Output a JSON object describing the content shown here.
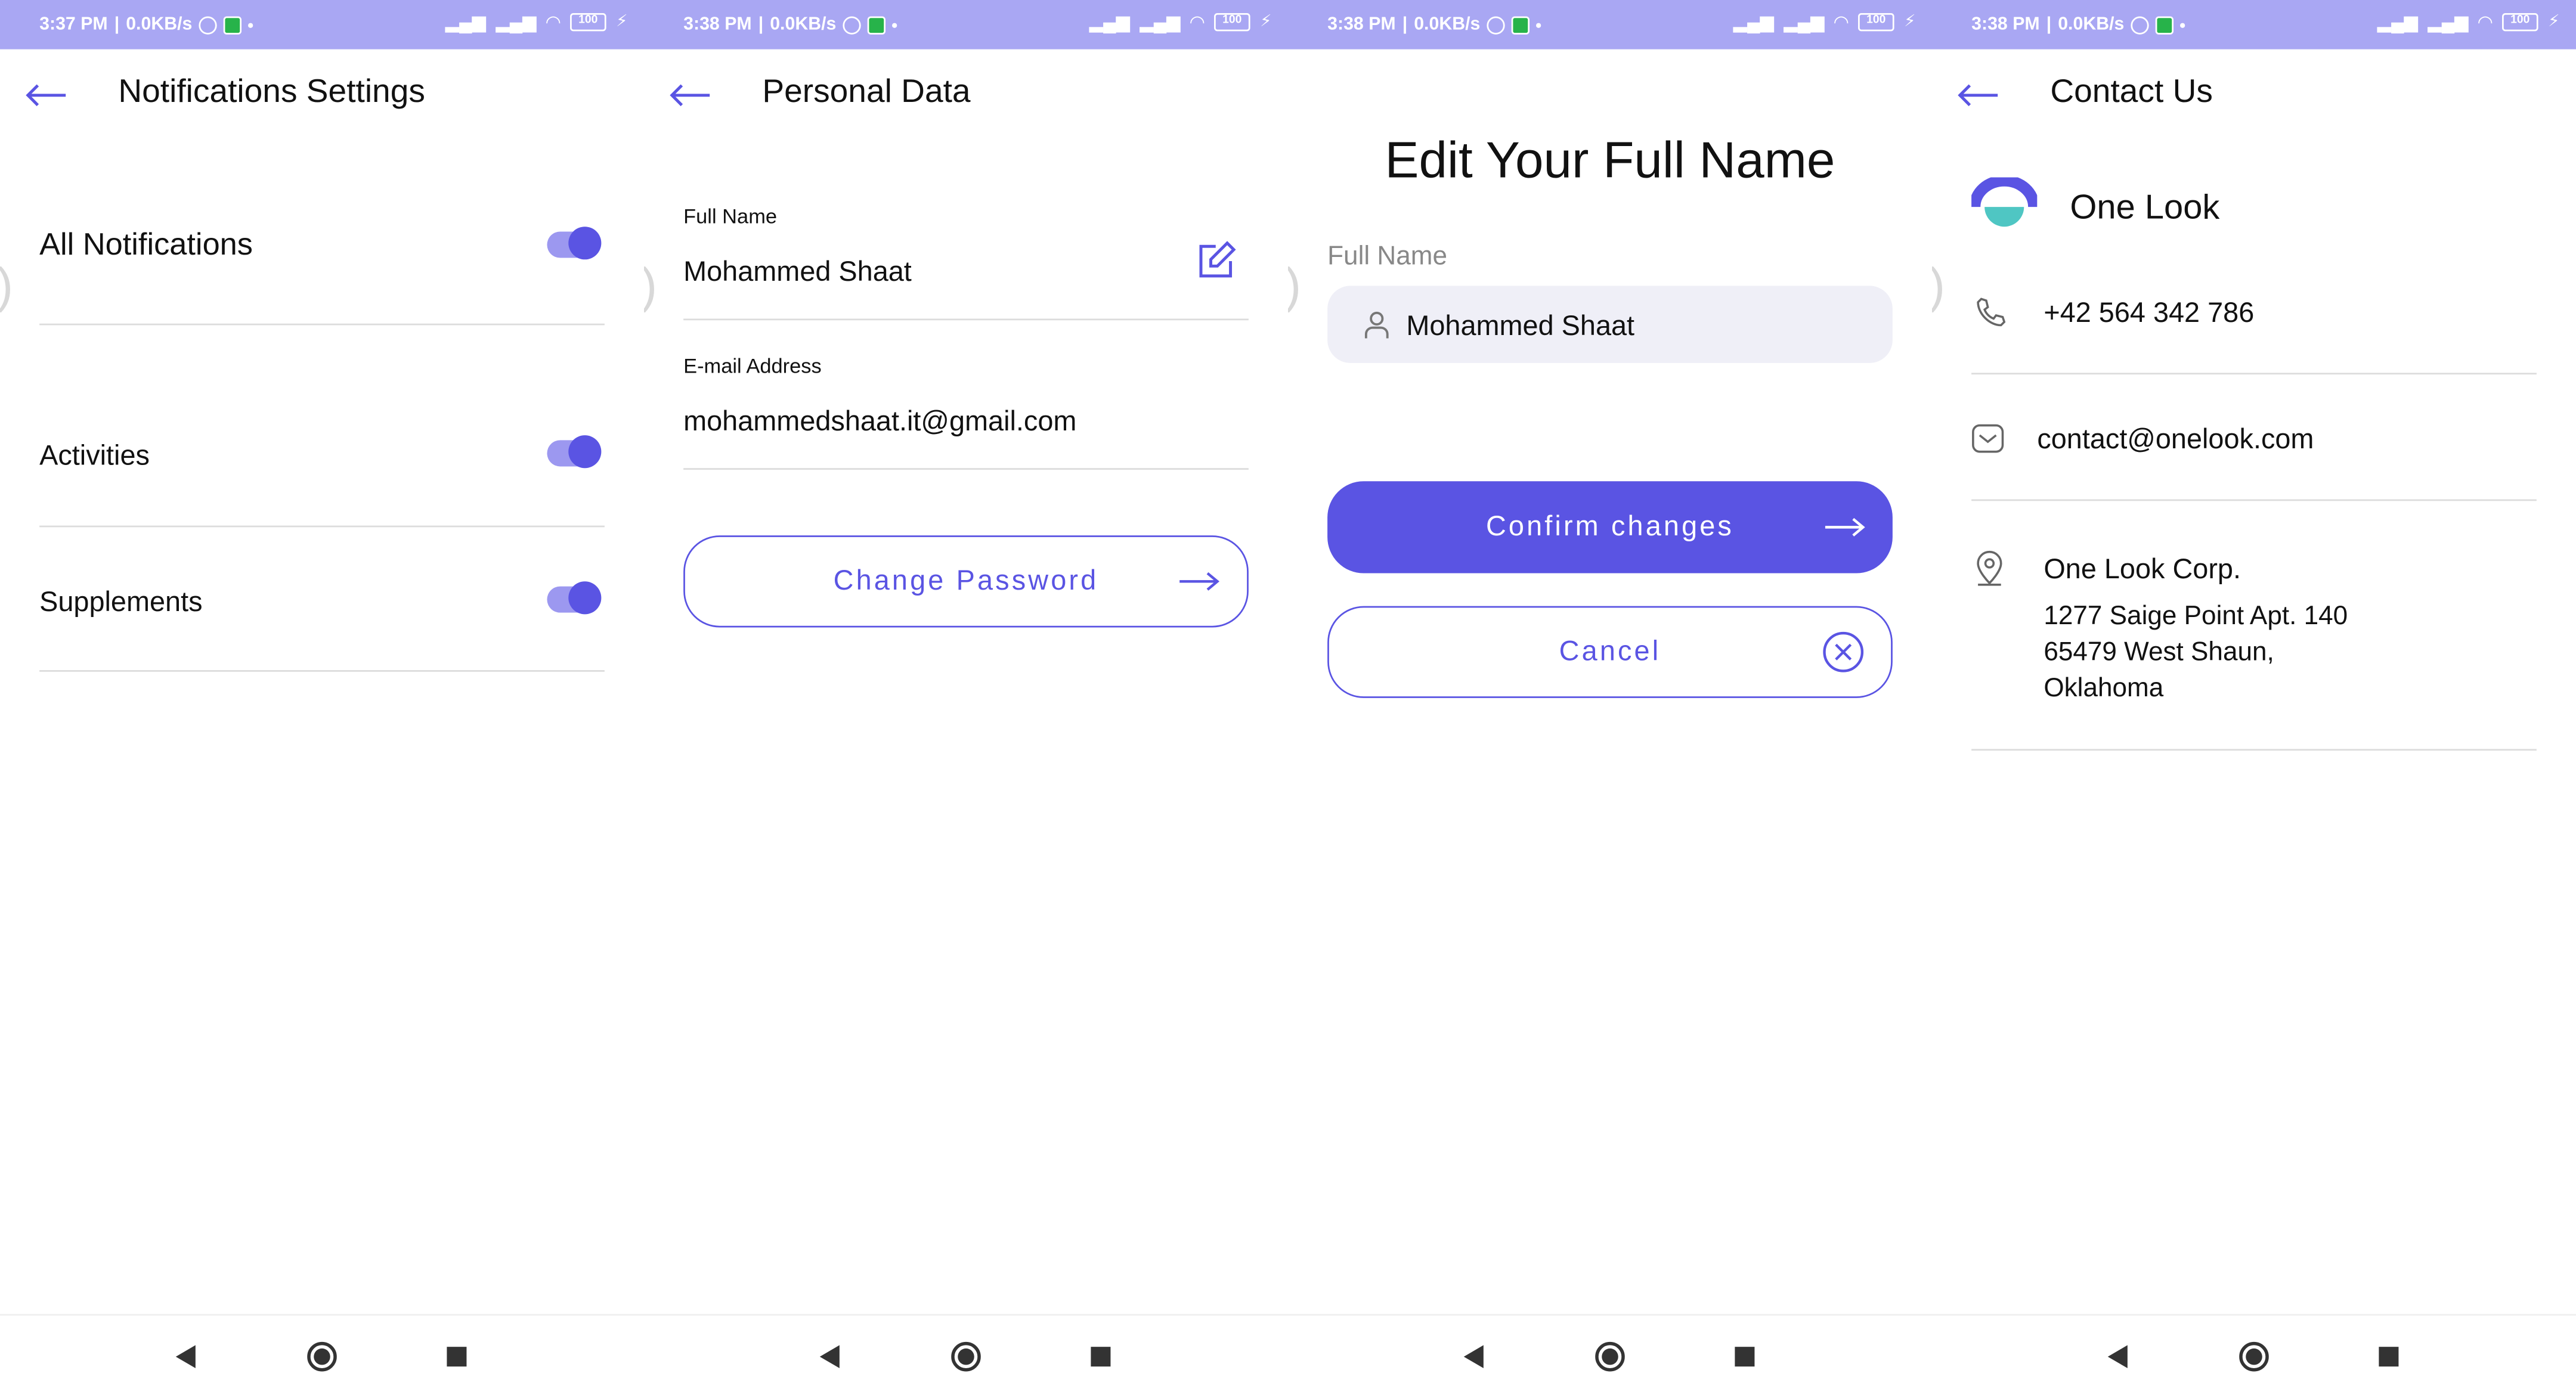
{
  "status_bars": [
    {
      "time": "3:37 PM",
      "speed": "0.0KB/s",
      "battery": "100"
    },
    {
      "time": "3:38 PM",
      "speed": "0.0KB/s",
      "battery": "100"
    },
    {
      "time": "3:38 PM",
      "speed": "0.0KB/s",
      "battery": "100"
    },
    {
      "time": "3:38 PM",
      "speed": "0.0KB/s",
      "battery": "100"
    }
  ],
  "notifications": {
    "title": "Notifications Settings",
    "items": [
      {
        "label": "All Notifications",
        "enabled": true
      },
      {
        "label": "Activities",
        "enabled": true
      },
      {
        "label": "Supplements",
        "enabled": true
      }
    ]
  },
  "personal": {
    "title": "Personal Data",
    "full_name_label": "Full Name",
    "full_name_value": "Mohammed Shaat",
    "email_label": "E-mail Address",
    "email_value": "mohammedshaat.it@gmail.com",
    "change_password_label": "Change Password"
  },
  "edit_name": {
    "heading": "Edit Your Full Name",
    "field_label": "Full Name",
    "field_value": "Mohammed Shaat",
    "confirm_label": "Confirm changes",
    "cancel_label": "Cancel"
  },
  "contact": {
    "title": "Contact Us",
    "brand": "One Look",
    "phone": "+42 564 342 786",
    "email": "contact@onelook.com",
    "company": "One Look Corp.",
    "address_line1": "1277 Saige Point Apt. 140",
    "address_line2": "65479 West Shaun,",
    "address_line3": "Oklahoma"
  },
  "colors": {
    "accent": "#5a54e3",
    "status_bar": "#a9a7f3",
    "brand_teal": "#4fc6c3"
  },
  "icons": [
    "back-arrow-icon",
    "edit-icon",
    "user-icon",
    "arrow-right-icon",
    "close-circle-icon",
    "phone-icon",
    "mail-icon",
    "location-pin-icon"
  ]
}
